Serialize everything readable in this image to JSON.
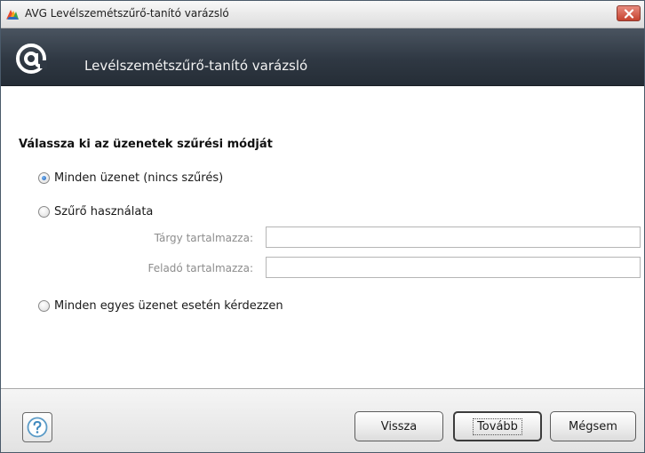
{
  "window": {
    "title": "AVG Levélszemétszűrő-tanító varázsló",
    "close_icon": "close-icon",
    "app_icon": "avg-logo-icon"
  },
  "header": {
    "title": "Levélszemétszűrő-tanító varázsló",
    "icon": "at-sign-icon"
  },
  "content": {
    "heading": "Válassza ki az üzenetek szűrési módját",
    "options": [
      {
        "label": "Minden üzenet (nincs szűrés)",
        "checked": true
      },
      {
        "label": "Szűrő használata",
        "checked": false
      },
      {
        "label": "Minden egyes üzenet esetén kérdezzen",
        "checked": false
      }
    ],
    "filter_fields": [
      {
        "label": "Tárgy tartalmazza:",
        "value": ""
      },
      {
        "label": "Feladó tartalmazza:",
        "value": ""
      }
    ]
  },
  "footer": {
    "help_icon": "help-icon",
    "back_label": "Vissza",
    "next_label": "Tovább",
    "cancel_label": "Mégsem"
  }
}
